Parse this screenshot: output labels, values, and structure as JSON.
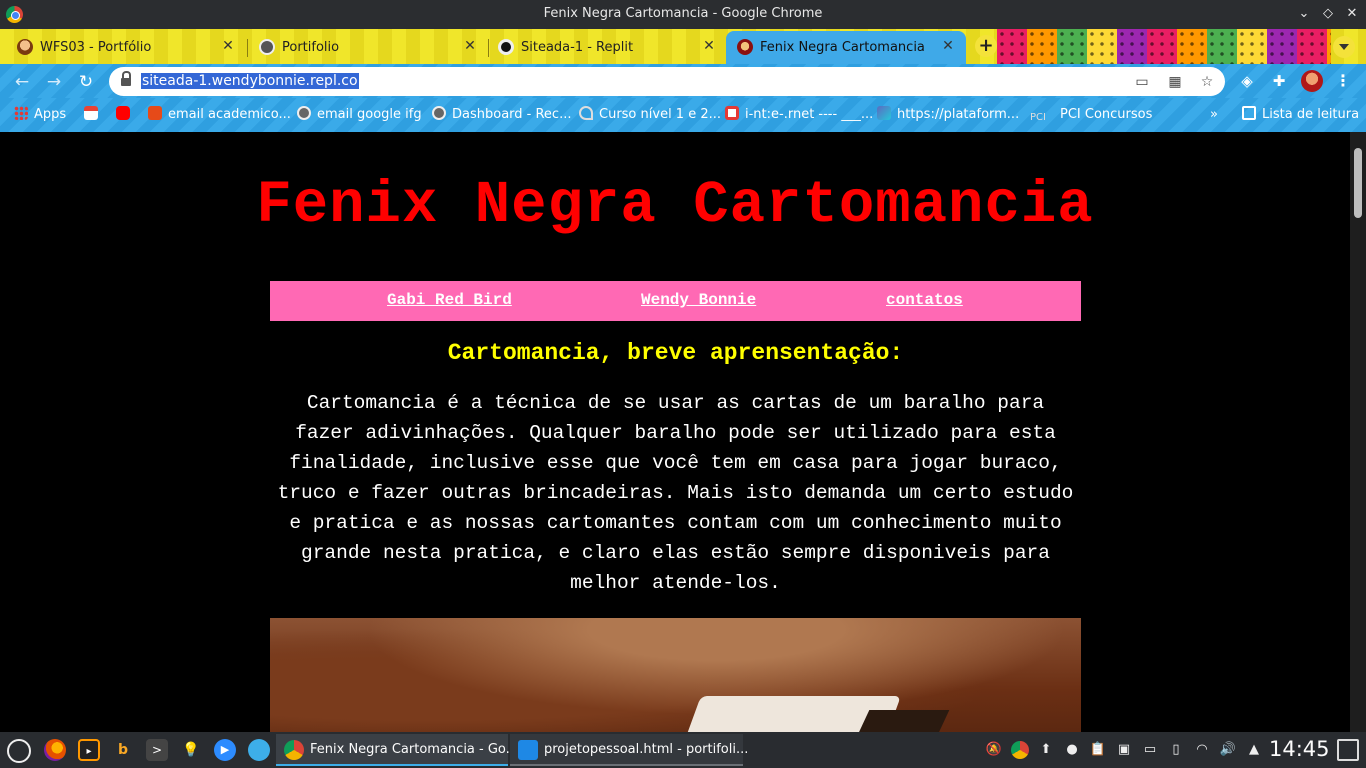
{
  "window": {
    "title": "Fenix Negra Cartomancia - Google Chrome"
  },
  "tabs": [
    {
      "label": "WFS03 - Portfólio",
      "icon": "avatar-favicon",
      "active": false
    },
    {
      "label": "Portifolio",
      "icon": "globe-icon",
      "active": false
    },
    {
      "label": "Siteada-1 - Replit",
      "icon": "replit-icon",
      "active": false
    },
    {
      "label": "Fenix Negra Cartomancia",
      "icon": "site-favicon",
      "active": true
    }
  ],
  "toolbar": {
    "url": "siteada-1.wendybonnie.repl.co"
  },
  "bookmarks": {
    "items": [
      {
        "label": "Apps",
        "icon": "apps-grid-icon"
      },
      {
        "label": "",
        "icon": "gmail-icon"
      },
      {
        "label": "",
        "icon": "youtube-icon"
      },
      {
        "label": "email academico...",
        "icon": "office-icon"
      },
      {
        "label": "email google ifg",
        "icon": "globe-icon"
      },
      {
        "label": "Dashboard - Rec...",
        "icon": "globe-icon"
      },
      {
        "label": "Curso nível 1 e 2...",
        "icon": "link-icon"
      },
      {
        "label": "i-nt:e-.rnet ---- ___...",
        "icon": "bookmark-icon"
      },
      {
        "label": "https://plataform...",
        "icon": "bookmark-icon"
      },
      {
        "label": "PCI Concursos",
        "icon": "pci-icon"
      }
    ],
    "reading_list": "Lista de leitura"
  },
  "page": {
    "title": "Fenix Negra Cartomancia",
    "nav": [
      "Gabi Red Bird",
      "Wendy Bonnie",
      "contatos"
    ],
    "heading": "Cartomancia, breve aprensentação:",
    "intro": "Cartomancia é a técnica de se usar as cartas de um baralho para fazer adivinhações. Qualquer baralho pode ser utilizado para esta finalidade, inclusive esse que você tem em casa para jogar buraco, truco e fazer outras brincadeiras. Mais isto demanda um certo estudo e pratica e as nossas cartomantes contam com um conhecimento muito grande nesta pratica, e claro elas estão sempre disponiveis para melhor atende-los."
  },
  "taskbar": {
    "tasks": [
      {
        "label": "Fenix Negra Cartomancia - Go...",
        "active": true
      },
      {
        "label": "projetopessoal.html - portifoli...",
        "active": false
      }
    ],
    "clock": "14:45"
  },
  "colors": {
    "site_title": "#ff0000",
    "site_nav_bg": "#ff69b4",
    "section_heading": "#ffff00",
    "page_bg": "#000000",
    "active_tab": "#3fa9e8"
  }
}
